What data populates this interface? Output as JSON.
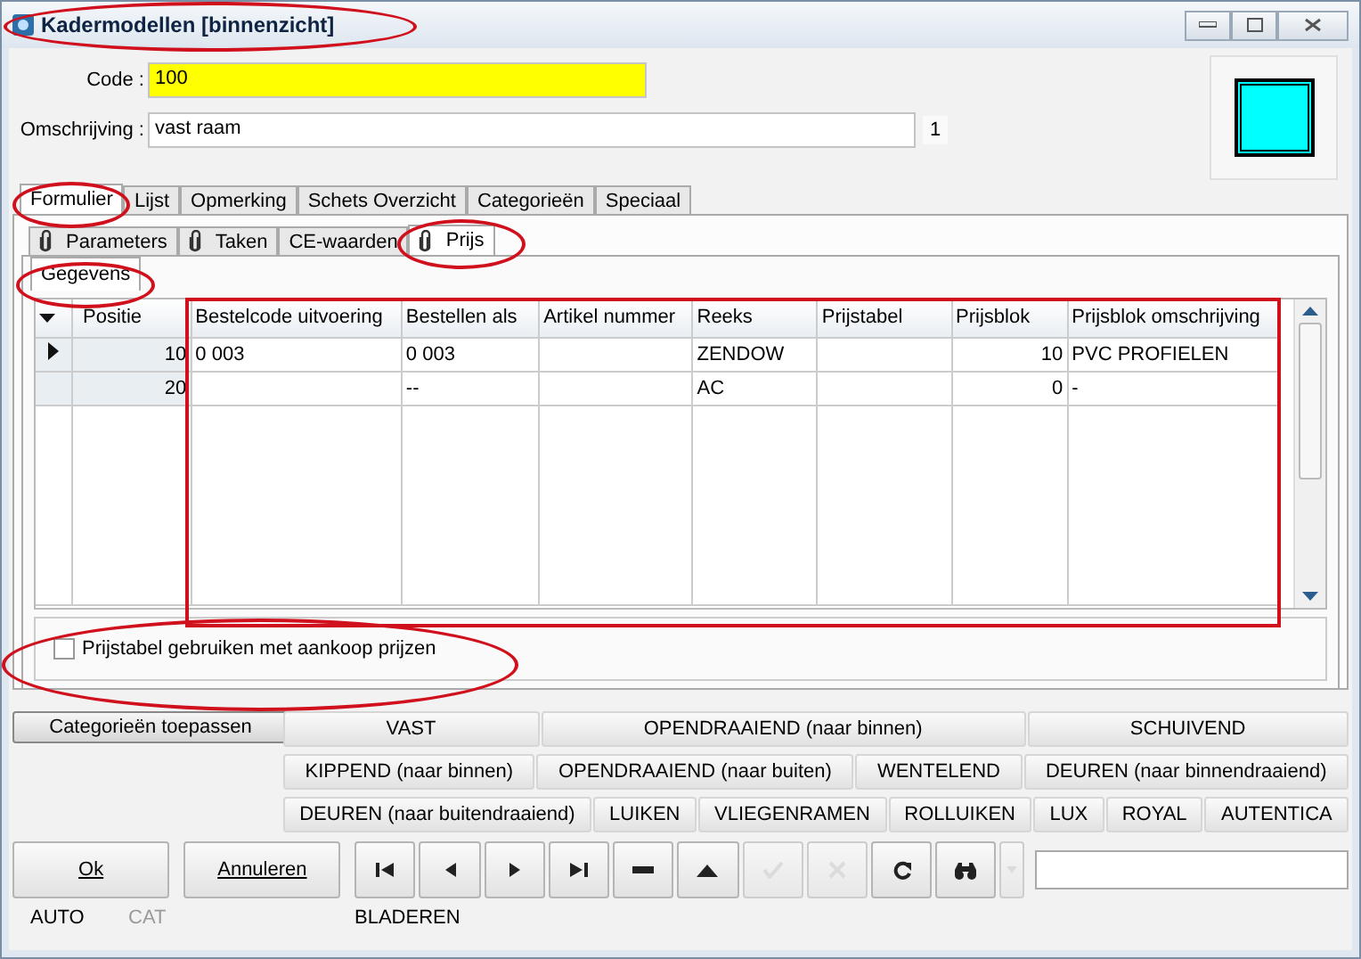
{
  "window": {
    "title": "Kadermodellen [binnenzicht]"
  },
  "form": {
    "code_label": "Code :",
    "code": "100",
    "description_label": "Omschrijving :",
    "description": "vast raam",
    "count": "1",
    "swatch": {
      "color": "#00ffff"
    }
  },
  "tabs": [
    {
      "label": "Formulier",
      "selected": true
    },
    {
      "label": "Lijst",
      "selected": false
    },
    {
      "label": "Opmerking",
      "selected": false
    },
    {
      "label": "Schets Overzicht",
      "selected": false
    },
    {
      "label": "Categorieën",
      "selected": false
    },
    {
      "label": "Speciaal",
      "selected": false
    }
  ],
  "subtabs": [
    {
      "label": "Parameters",
      "clip": true,
      "selected": false
    },
    {
      "label": "Taken",
      "clip": true,
      "selected": false
    },
    {
      "label": "CE-waarden",
      "clip": false,
      "selected": false
    },
    {
      "label": "Prijs",
      "clip": true,
      "selected": true
    }
  ],
  "section_tab": {
    "label": "Gegevens"
  },
  "table": {
    "columns": [
      "Positie",
      "Bestelcode uitvoering",
      "Bestellen als",
      "Artikel nummer",
      "Reeks",
      "Prijstabel",
      "Prijsblok",
      "Prijsblok omschrijving"
    ],
    "rows": [
      {
        "selected": true,
        "cells": [
          "10",
          "0 003",
          "0 003",
          "",
          "ZENDOW",
          "",
          "10",
          "PVC PROFIELEN"
        ]
      },
      {
        "selected": false,
        "cells": [
          "20",
          "",
          "--",
          "",
          "AC",
          "",
          "0",
          "-"
        ]
      }
    ]
  },
  "option": {
    "label": "Prijstabel gebruiken met aankoop prijzen",
    "checked": false
  },
  "apply_button": "Categorieën toepassen",
  "category_rows": [
    [
      "VAST",
      "OPENDRAAIEND (naar binnen)",
      "SCHUIVEND"
    ],
    [
      "KIPPEND (naar binnen)",
      "OPENDRAAIEND (naar buiten)",
      "WENTELEND",
      "DEUREN (naar binnendraaiend)"
    ],
    [
      "DEUREN (naar buitendraaiend)",
      "LUIKEN",
      "VLIEGENRAMEN",
      "ROLLUIKEN",
      "LUX",
      "ROYAL",
      "AUTENTICA"
    ]
  ],
  "buttons": [
    {
      "label": "Ok"
    },
    {
      "label": "Annuleren"
    }
  ],
  "nav": [
    {
      "kind": "first",
      "disabled": false
    },
    {
      "kind": "prev",
      "disabled": false
    },
    {
      "kind": "next",
      "disabled": false
    },
    {
      "kind": "last",
      "disabled": false
    },
    {
      "kind": "delete",
      "disabled": false
    },
    {
      "kind": "insert",
      "disabled": false
    },
    {
      "kind": "check",
      "disabled": true
    },
    {
      "kind": "cancel",
      "disabled": true
    },
    {
      "kind": "refresh",
      "disabled": false
    },
    {
      "kind": "search",
      "disabled": false
    },
    {
      "kind": "dropdown",
      "disabled": true
    }
  ],
  "status_bar": [
    {
      "text": "AUTO",
      "disabled": false
    },
    {
      "text": "CAT",
      "disabled": true
    },
    {
      "text": "BLADEREN",
      "disabled": false
    }
  ],
  "annotations": [
    {
      "kind": "ellipse"
    },
    {
      "kind": "ellipse"
    },
    {
      "kind": "ellipse"
    },
    {
      "kind": "ellipse"
    },
    {
      "kind": "rectangle"
    },
    {
      "kind": "ellipse"
    }
  ]
}
